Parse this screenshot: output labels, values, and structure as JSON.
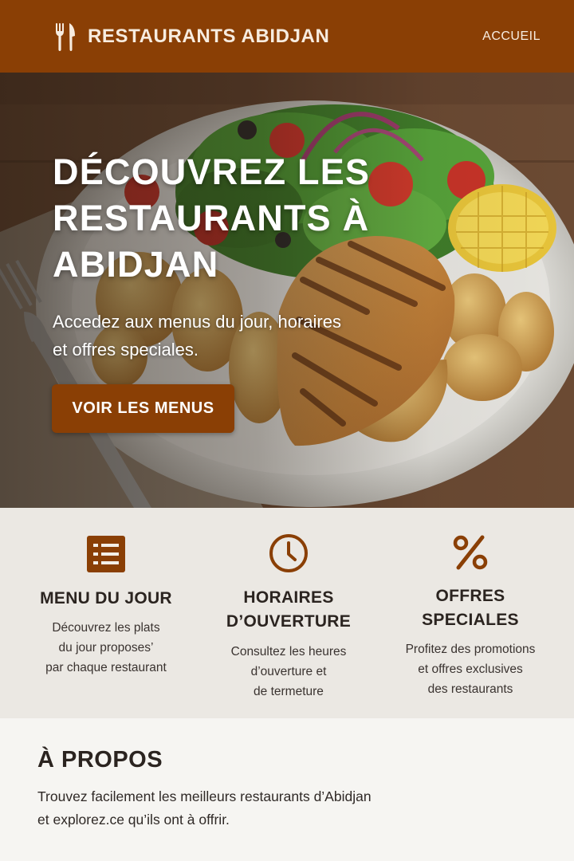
{
  "header": {
    "brand_icon": "fork-knife-icon",
    "brand_title": "RESTAURANTS ABIDJAN",
    "nav_home": "ACCUEIL",
    "color": "#8a3f05"
  },
  "hero": {
    "title_line1": "DÉCOUVREZ LES",
    "title_line2": "RESTAURANTS À",
    "title_line3": "ABIDJAN",
    "subtitle_line1": "Accedez aux menus du jour, horaires",
    "subtitle_line2": "et offres speciales.",
    "cta_label": "VOIR LES MENUS",
    "background": "grilled-chicken-plate-photo"
  },
  "features": [
    {
      "icon": "menu-list-icon",
      "title_lines": [
        "MENU DU JOUR"
      ],
      "desc_lines": [
        "Découvrez les plats",
        "du jour proposes’",
        "par chaque restaurant"
      ]
    },
    {
      "icon": "clock-icon",
      "title_lines": [
        "HORAIRES",
        "D’OUVERTURE"
      ],
      "desc_lines": [
        "Consultez les heures",
        "d’ouverture et",
        "de termeture"
      ]
    },
    {
      "icon": "percent-icon",
      "title_lines": [
        "OFFRES",
        "SPECIALES"
      ],
      "desc_lines": [
        "Profitez des promotions",
        "et offres exclusives",
        "des restaurants"
      ]
    }
  ],
  "about": {
    "title": "À PROPOS",
    "text_line1": "Trouvez facilement les meilleurs restaurants d’Abidjan",
    "text_line2": "et explorez.ce qu’ils ont à offrir."
  },
  "colors": {
    "accent": "#8a3f05",
    "features_bg": "#ebe8e3",
    "about_bg": "#f6f5f2"
  }
}
